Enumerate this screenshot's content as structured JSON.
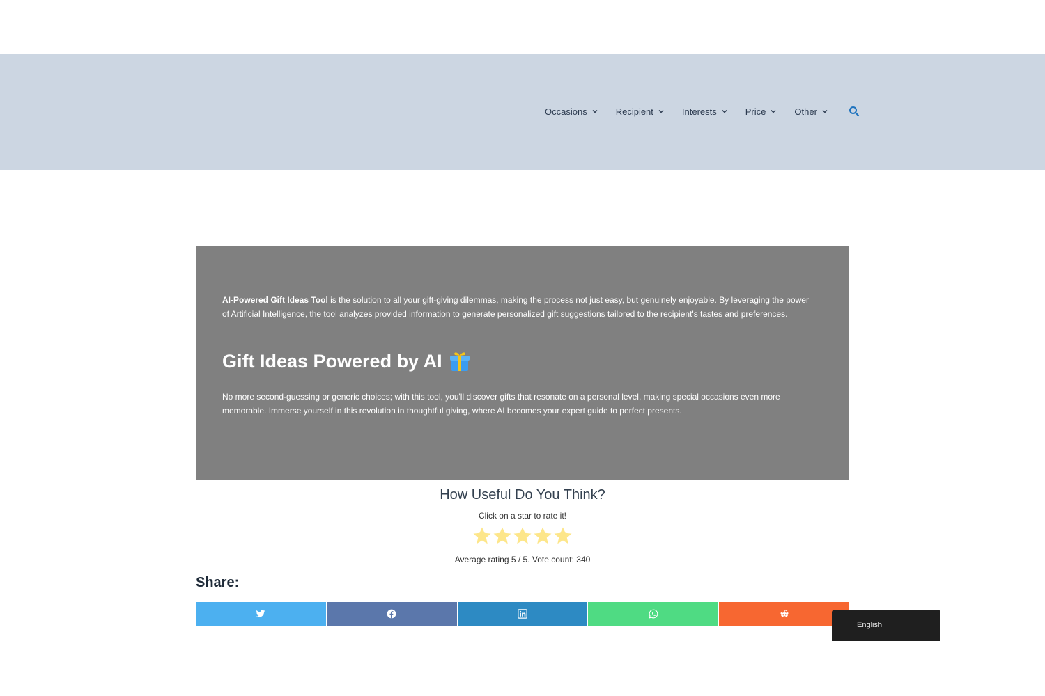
{
  "nav": {
    "items": [
      {
        "label": "Occasions"
      },
      {
        "label": "Recipient"
      },
      {
        "label": "Interests"
      },
      {
        "label": "Price"
      },
      {
        "label": "Other"
      }
    ],
    "search_icon": "search-icon"
  },
  "hero": {
    "intro_bold": "AI-Powered Gift Ideas Tool",
    "intro_rest": " is the solution to all your gift-giving dilemmas, making the process not just easy, but genuinely enjoyable. By leveraging the power of Artificial Intelligence, the tool analyzes provided information to generate personalized gift suggestions tailored to the recipient's tastes and preferences.",
    "title": "Gift Ideas Powered by AI",
    "title_icon": "gift-icon",
    "body": "No more second-guessing or generic choices; with this tool, you'll discover gifts that resonate on a personal level, making special occasions even more memorable. Immerse yourself in this revolution in thoughtful giving, where AI becomes your expert guide to perfect presents."
  },
  "rating": {
    "title": "How Useful Do You Think?",
    "subtitle": "Click on a star to rate it!",
    "stars_total": 5,
    "stars_filled": 5,
    "average_text": "Average rating 5 / 5. Vote count: 340",
    "star_color": "#fde68a"
  },
  "share": {
    "title": "Share:",
    "buttons": [
      {
        "network": "twitter",
        "icon": "twitter-icon",
        "color": "#4cb0f0"
      },
      {
        "network": "facebook",
        "icon": "facebook-icon",
        "color": "#5b77ab"
      },
      {
        "network": "linkedin",
        "icon": "linkedin-icon",
        "color": "#2d8ac3"
      },
      {
        "network": "whatsapp",
        "icon": "whatsapp-icon",
        "color": "#4fdb83"
      },
      {
        "network": "reddit",
        "icon": "reddit-icon",
        "color": "#f76731"
      }
    ]
  },
  "language": {
    "label": "English"
  },
  "colors": {
    "header_bg": "#ccd6e2",
    "hero_bg": "#808080",
    "accent": "#1e73be"
  }
}
